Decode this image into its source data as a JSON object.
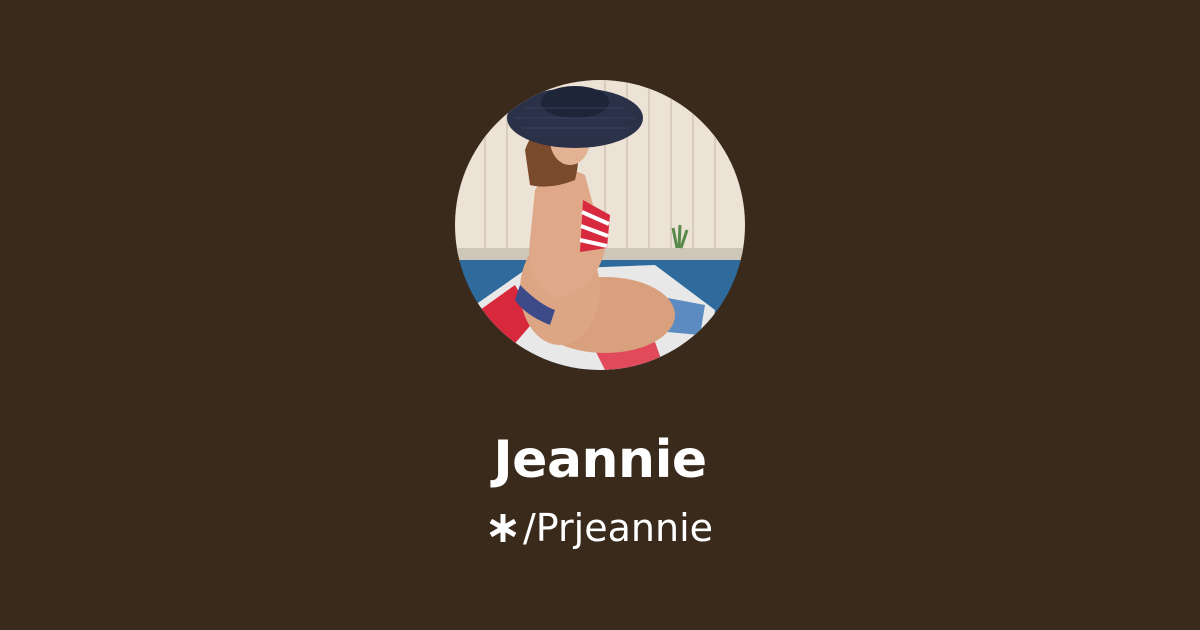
{
  "profile": {
    "name": "Jeannie",
    "handle": "/Prjeannie",
    "avatar_icon": "profile-photo",
    "handle_icon": "linktree-asterisk-icon"
  },
  "colors": {
    "background": "#3a2a1c",
    "text": "#ffffff"
  }
}
